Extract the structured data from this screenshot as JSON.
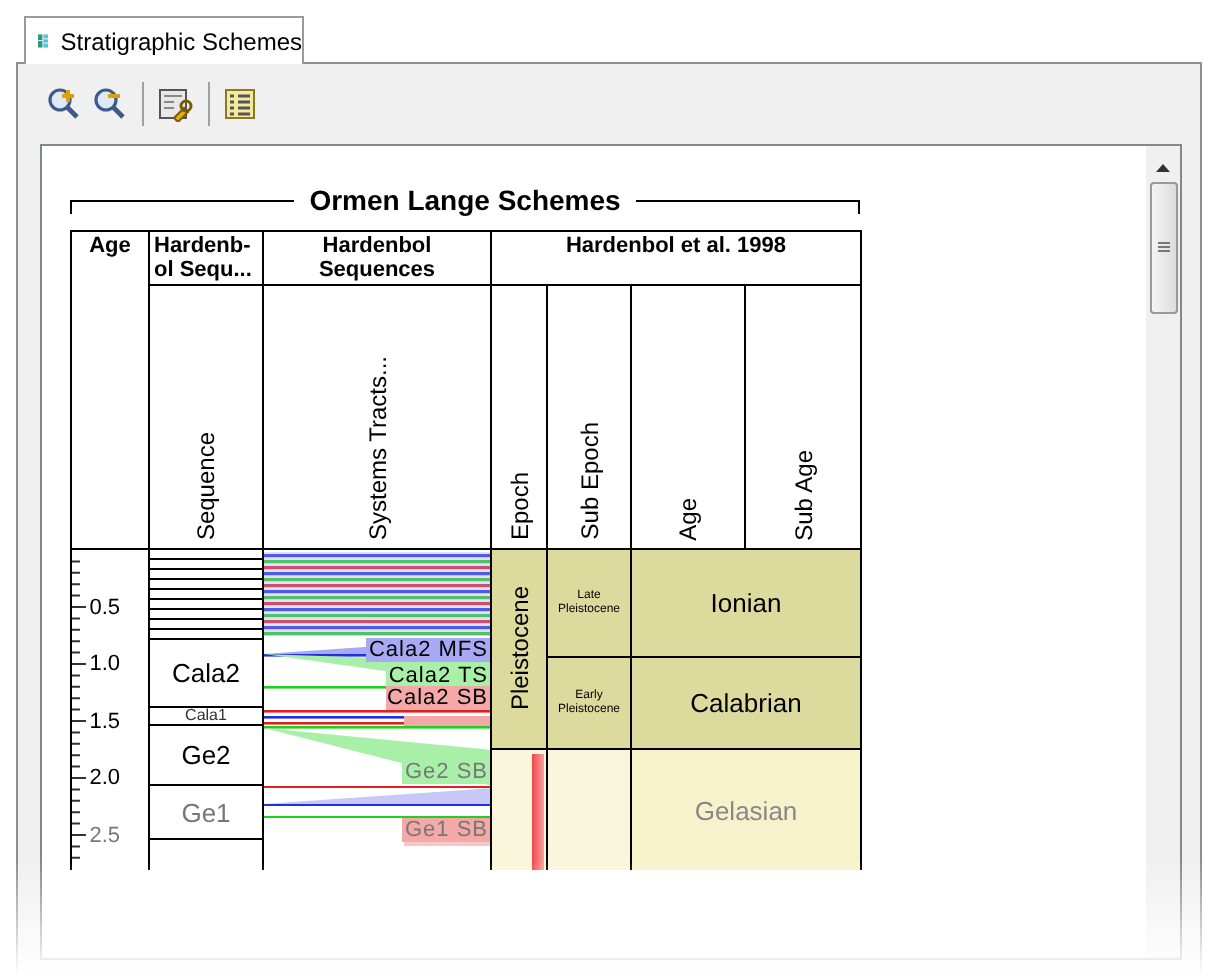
{
  "tab": {
    "label": "Stratigraphic Schemes",
    "selected": true
  },
  "chart": {
    "title": "Ormen Lange Schemes",
    "groups": [
      {
        "label": "Age"
      },
      {
        "label": "Hardenb-ol Sequ...",
        "columns": [
          "Sequence"
        ]
      },
      {
        "label": "Hardenbol Sequences",
        "columns": [
          "Systems Tracts..."
        ]
      },
      {
        "label": "Hardenbol et al. 1998",
        "columns": [
          "Epoch",
          "Sub Epoch",
          "Age",
          "Sub Age"
        ]
      }
    ],
    "age_ticks": [
      "0.5",
      "1.0",
      "1.5",
      "2.0",
      "2.5"
    ],
    "sequences": [
      "Cala2",
      "Cala1",
      "Ge2",
      "Ge1"
    ],
    "systems_tracts": [
      {
        "label": "Cala2 MFS",
        "color": "#a8a8f4"
      },
      {
        "label": "Cala2 TS",
        "color": "#a8f0a8"
      },
      {
        "label": "Cala2 SB",
        "color": "#f4a8a8"
      },
      {
        "label": "Ge2 SB",
        "color": "#a8f0a8"
      },
      {
        "label": "Ge1 SB",
        "color": "#f4a8a8"
      }
    ],
    "epochs": [
      "Pleistocene"
    ],
    "sub_epochs": [
      "Late Pleistocene",
      "Early Pleistocene"
    ],
    "ages": [
      "Ionian",
      "Calabrian",
      "Gelasian"
    ]
  }
}
